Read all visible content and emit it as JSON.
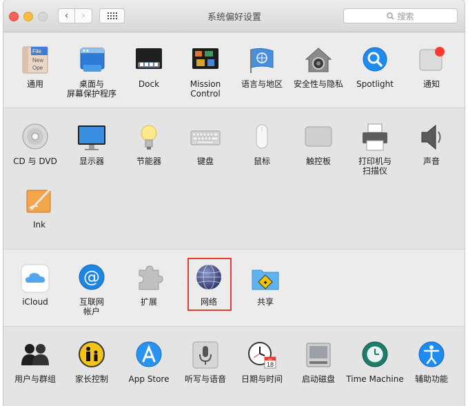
{
  "window": {
    "title": "系统偏好设置"
  },
  "toolbar": {
    "back": "‹",
    "forward": "›"
  },
  "search": {
    "placeholder": "搜索",
    "icon": "magnifier-icon"
  },
  "sections": [
    {
      "items": [
        "通用",
        "桌面与\n屏幕保护程序",
        "Dock",
        "Mission\nControl",
        "语言与地区",
        "安全性与隐私",
        "Spotlight",
        "通知"
      ]
    },
    {
      "items": [
        "CD 与 DVD",
        "显示器",
        "节能器",
        "键盘",
        "鼠标",
        "触控板",
        "打印机与\n扫描仪",
        "声音",
        "Ink"
      ]
    },
    {
      "items": [
        "iCloud",
        "互联网\n帐户",
        "扩展",
        "网络",
        "共享"
      ]
    },
    {
      "items": [
        "用户与群组",
        "家长控制",
        "App Store",
        "听写与语音",
        "日期与时间",
        "启动磁盘",
        "Time Machine",
        "辅助功能"
      ]
    }
  ],
  "icon_texts": {
    "file": "File",
    "new": "New",
    "ope": "Ope",
    "cal_day": "18",
    "cal_month": "JUL"
  },
  "colors": {
    "highlight": "#e53935",
    "accent": "#1e8bf0"
  }
}
